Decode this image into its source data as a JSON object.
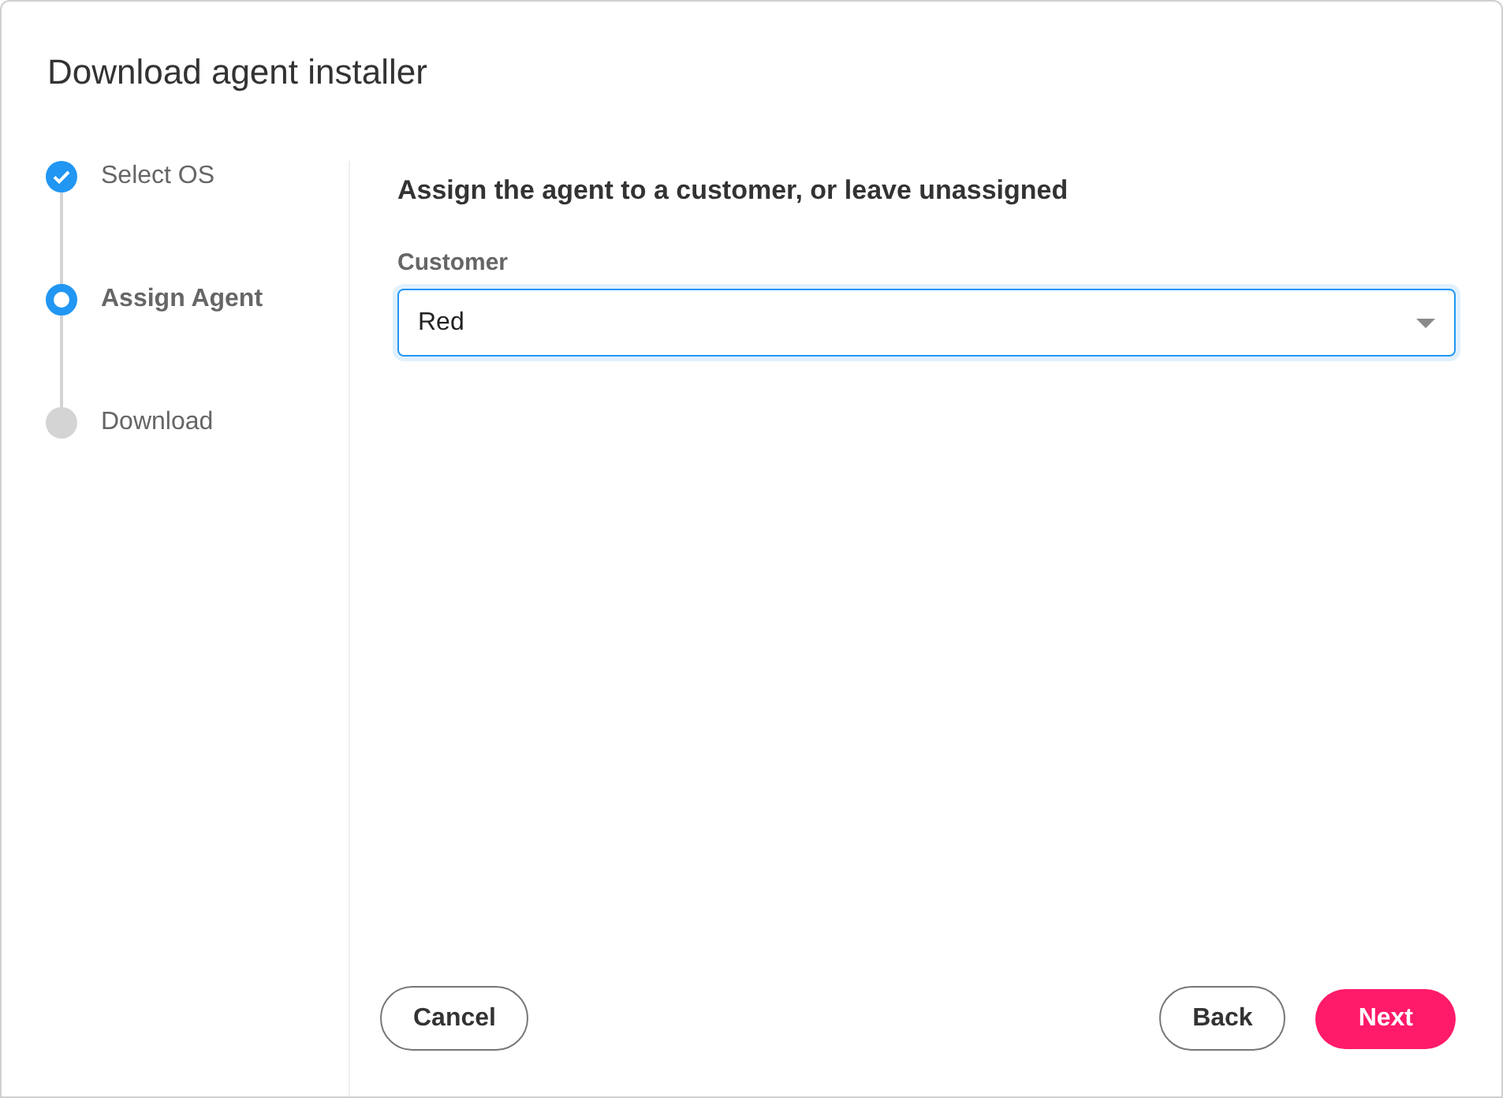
{
  "window": {
    "title": "Download agent installer"
  },
  "steps": [
    {
      "label": "Select OS",
      "kind": "done"
    },
    {
      "label": "Assign Agent",
      "kind": "current"
    },
    {
      "label": "Download",
      "kind": "pending"
    }
  ],
  "heading": "Assign the agent to a customer, or leave unassigned",
  "customer": {
    "label": "Customer",
    "value": "Red",
    "focused": true
  },
  "buttons": {
    "cancel": "Cancel",
    "back": "Back",
    "next": "Next"
  }
}
